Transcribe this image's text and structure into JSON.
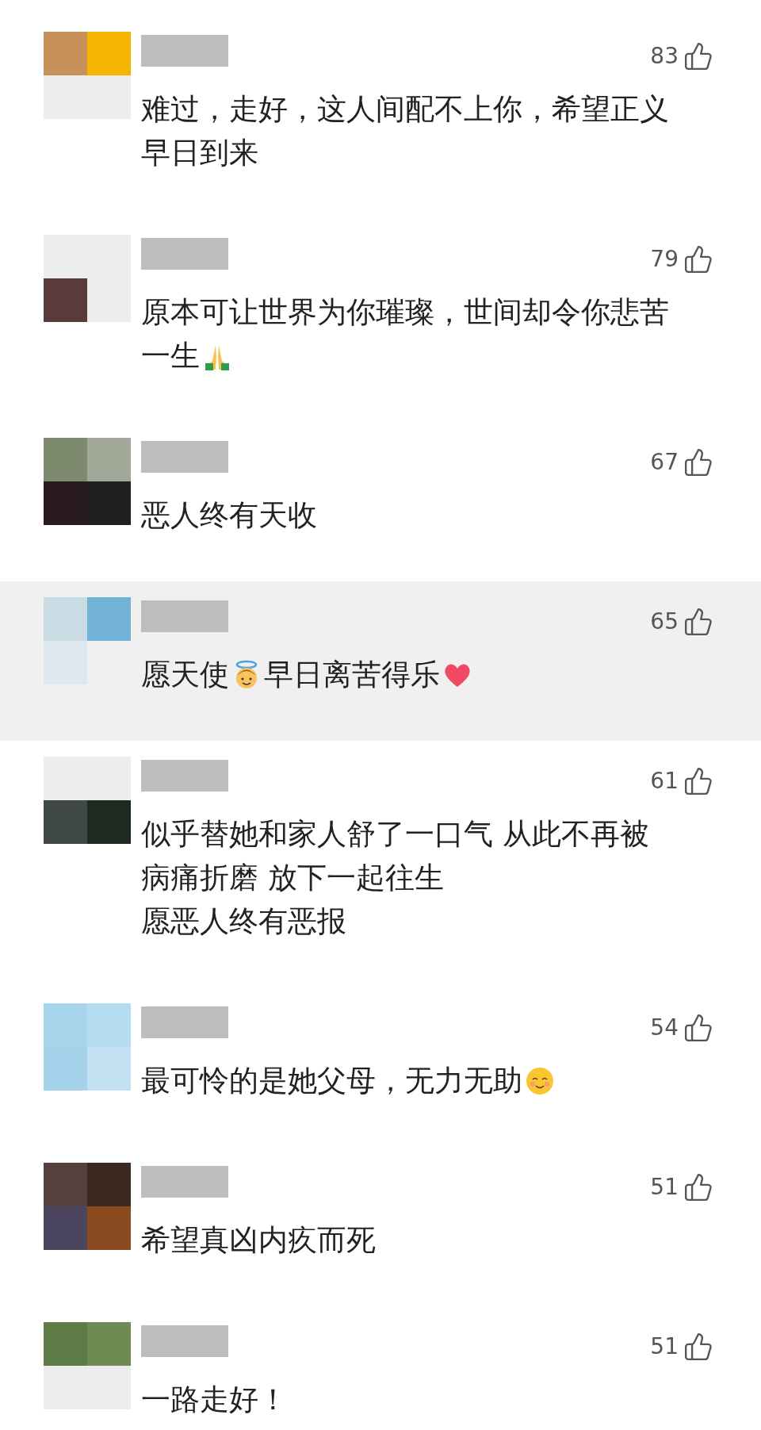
{
  "comments": [
    {
      "likes": "83",
      "highlighted": false,
      "lines": [
        [
          {
            "kind": "text",
            "text": "难过，走好，这人间配不上你，希望正义"
          }
        ],
        [
          {
            "kind": "text",
            "text": "早日到来"
          }
        ]
      ]
    },
    {
      "likes": "79",
      "highlighted": false,
      "lines": [
        [
          {
            "kind": "text",
            "text": "原本可让世界为你璀璨，世间却令你悲苦"
          }
        ],
        [
          {
            "kind": "text",
            "text": "一生"
          },
          {
            "kind": "pray"
          }
        ]
      ]
    },
    {
      "likes": "67",
      "highlighted": false,
      "lines": [
        [
          {
            "kind": "text",
            "text": "恶人终有天收"
          }
        ]
      ]
    },
    {
      "likes": "65",
      "highlighted": true,
      "lines": [
        [
          {
            "kind": "text",
            "text": "愿天使"
          },
          {
            "kind": "angel"
          },
          {
            "kind": "text",
            "text": "早日离苦得乐"
          },
          {
            "kind": "heart"
          }
        ]
      ]
    },
    {
      "likes": "61",
      "highlighted": false,
      "lines": [
        [
          {
            "kind": "text",
            "text": "似乎替她和家人舒了一口气 从此不再被"
          }
        ],
        [
          {
            "kind": "text",
            "text": "病痛折磨 放下一起往生"
          }
        ],
        [
          {
            "kind": "text",
            "text": "愿恶人终有恶报"
          }
        ]
      ]
    },
    {
      "likes": "54",
      "highlighted": false,
      "lines": [
        [
          {
            "kind": "text",
            "text": "最可怜的是她父母，无力无助"
          },
          {
            "kind": "smile"
          }
        ]
      ]
    },
    {
      "likes": "51",
      "highlighted": false,
      "lines": [
        [
          {
            "kind": "text",
            "text": "希望真凶内疚而死"
          }
        ]
      ]
    },
    {
      "likes": "51",
      "highlighted": false,
      "lines": [
        [
          {
            "kind": "text",
            "text": "一路走好！"
          }
        ]
      ]
    }
  ]
}
